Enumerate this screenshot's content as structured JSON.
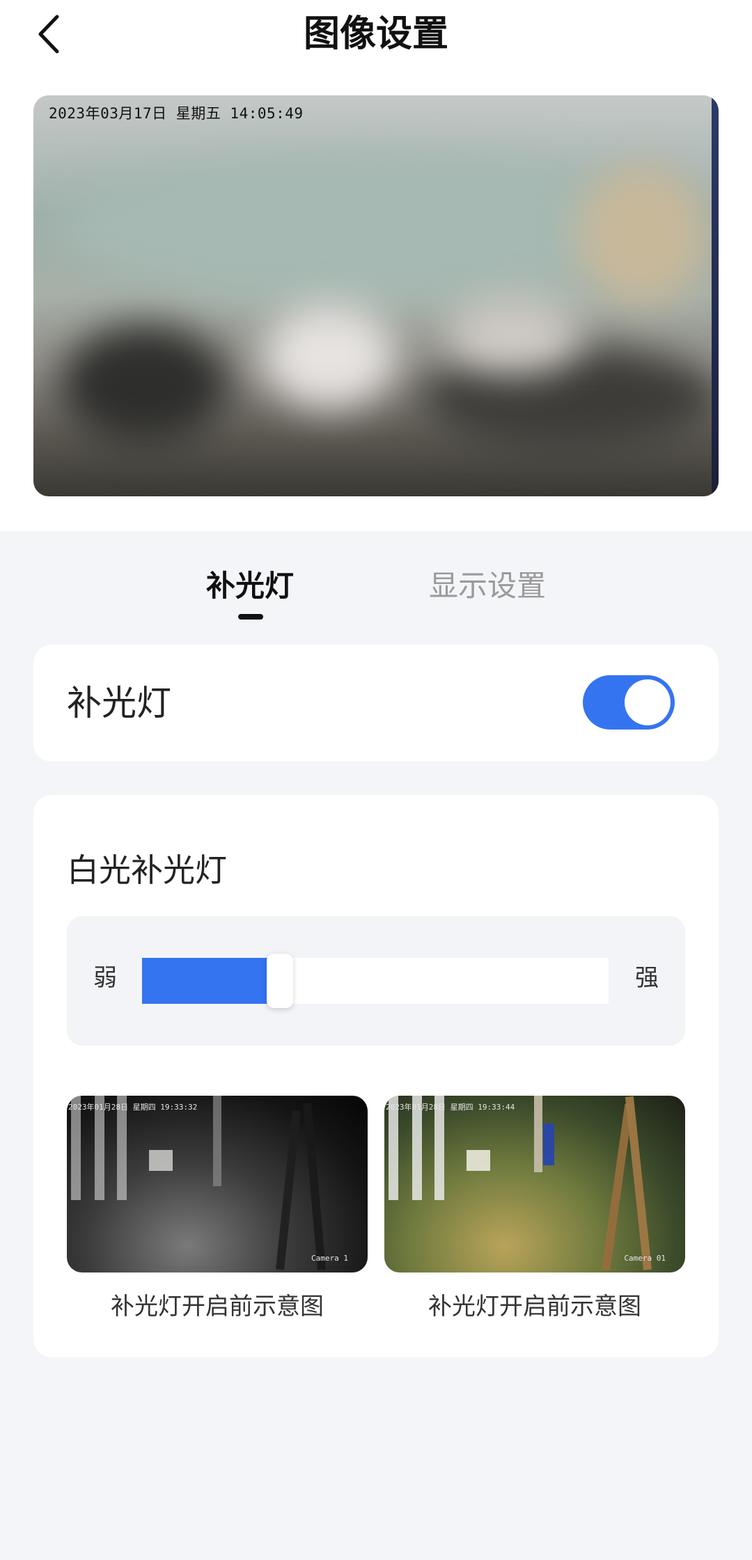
{
  "header": {
    "title": "图像设置",
    "back_icon": "chevron-left-icon"
  },
  "preview": {
    "timestamp": "2023年03月17日 星期五 14:05:49"
  },
  "tabs": [
    {
      "label": "补光灯",
      "active": true
    },
    {
      "label": "显示设置",
      "active": false
    }
  ],
  "fill_light": {
    "label": "补光灯",
    "enabled": true
  },
  "white_light": {
    "title": "白光补光灯",
    "min_label": "弱",
    "max_label": "强",
    "level": 0.27
  },
  "examples": [
    {
      "caption": "补光灯开启前示意图",
      "overlay": "2023年01月28日 星期四 19:33:32",
      "camera": "Camera 1"
    },
    {
      "caption": "补光灯开启前示意图",
      "overlay": "2023年01月28日 星期四 19:33:44",
      "camera": "Camera 01"
    }
  ],
  "colors": {
    "accent": "#3574f0",
    "background": "#f4f5f9",
    "card": "#ffffff"
  }
}
